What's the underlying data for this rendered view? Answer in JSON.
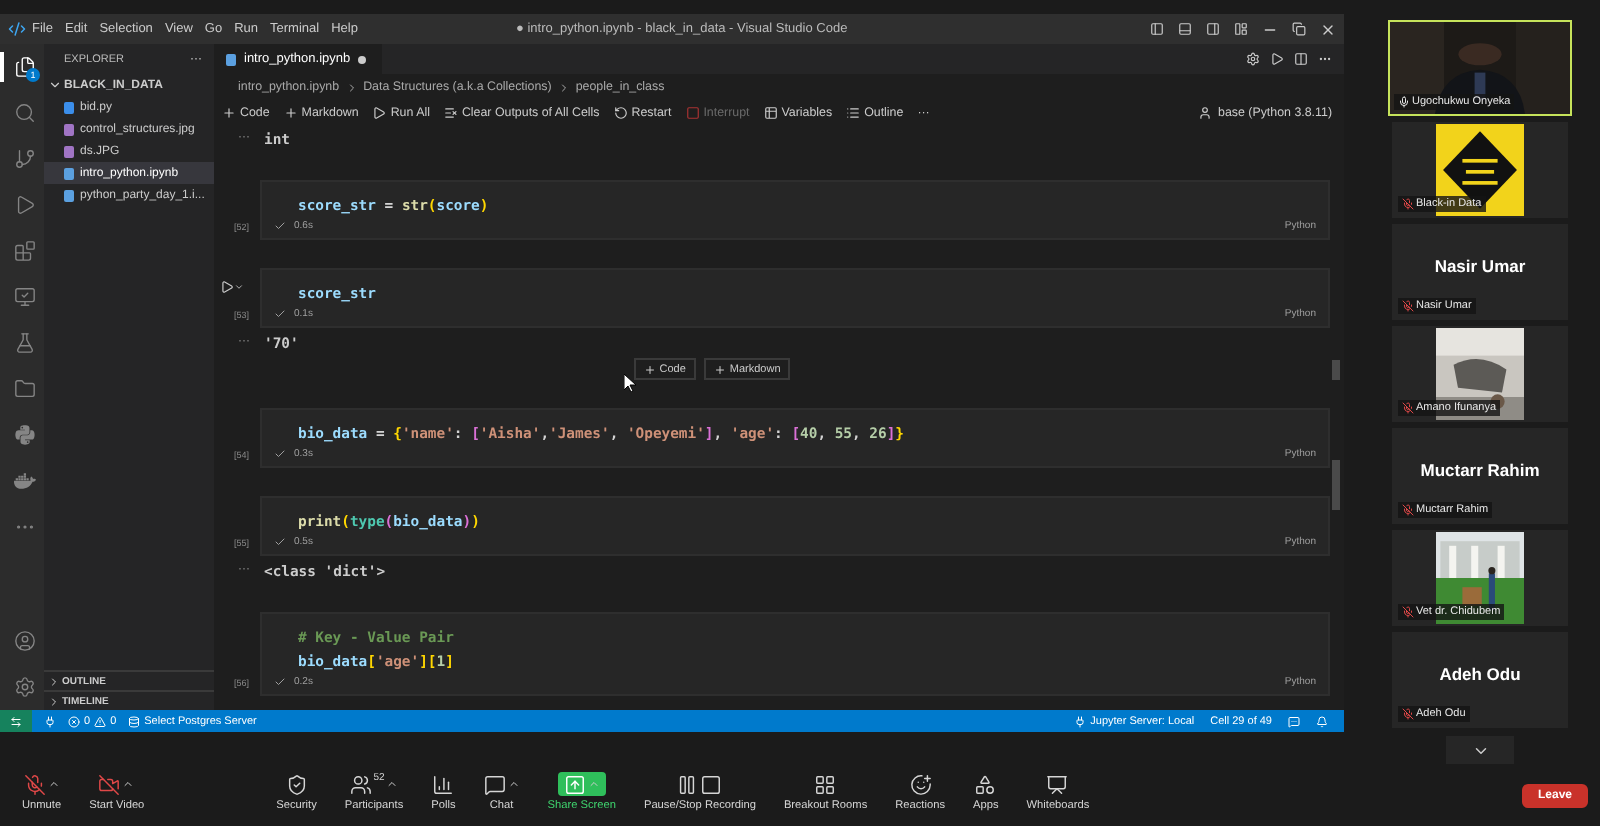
{
  "title_bar": {
    "menu": [
      "File",
      "Edit",
      "Selection",
      "View",
      "Go",
      "Run",
      "Terminal",
      "Help"
    ],
    "title": "● intro_python.ipynb - black_in_data - Visual Studio Code"
  },
  "activity_bar": [
    {
      "kind": "files",
      "selected": true,
      "badge": "1"
    },
    {
      "kind": "search",
      "selected": false
    },
    {
      "kind": "source_control",
      "selected": false
    },
    {
      "kind": "run",
      "selected": false
    },
    {
      "kind": "extensions",
      "selected": false
    },
    {
      "kind": "remote",
      "selected": false
    },
    {
      "kind": "testing",
      "selected": false
    },
    {
      "kind": "folder",
      "selected": false
    },
    {
      "kind": "python",
      "selected": false
    },
    {
      "kind": "docker",
      "selected": false
    },
    {
      "kind": "more",
      "selected": false
    }
  ],
  "sidebar": {
    "title": "EXPLORER",
    "more": "···",
    "folder": {
      "name": "BLACK_IN_DATA",
      "expanded": true,
      "files": [
        {
          "name": "bid.py",
          "kind": "python",
          "selected": false
        },
        {
          "name": "control_structures.jpg",
          "selected": false
        },
        {
          "name": "ds.JPG",
          "selected": false
        },
        {
          "name": "intro_python.ipynb",
          "kind": "notebook",
          "selected": true
        },
        {
          "name": "python_party_day_1.i...",
          "kind": "notebook",
          "selected": false
        }
      ]
    },
    "sections": [
      {
        "name": "OUTLINE",
        "expanded": false
      },
      {
        "name": "TIMELINE",
        "expanded": false
      }
    ]
  },
  "tabs": [
    {
      "label": "intro_python.ipynb",
      "selected": true,
      "dirty": true
    }
  ],
  "breadcrumb": [
    "intro_python.ipynb",
    "Data Structures (a.k.a Collections)",
    "people_in_class"
  ],
  "toolbar": {
    "actions": [
      {
        "label": "Code",
        "kind": "add",
        "disabled": false
      },
      {
        "label": "Markdown",
        "kind": "add",
        "disabled": false
      },
      {
        "label": "Run All",
        "kind": "run",
        "disabled": false
      },
      {
        "label": "Clear Outputs of All Cells",
        "kind": "clear",
        "disabled": false
      },
      {
        "label": "Restart",
        "kind": "restart",
        "disabled": false
      },
      {
        "label": "Interrupt",
        "kind": "interrupt",
        "disabled": true
      },
      {
        "label": "Variables",
        "kind": "variables",
        "disabled": false
      },
      {
        "label": "Outline",
        "kind": "outline",
        "disabled": false
      }
    ],
    "more": "···",
    "kernel": "base (Python 3.8.11)"
  },
  "notebook": [
    {
      "kind": "output",
      "prompt": "···",
      "text": "int"
    },
    {
      "kind": "cell",
      "label": "[52]",
      "run_control": false,
      "time": "0.6s",
      "language": "Python",
      "lines": [
        [
          {
            "text": "score_str",
            "kind": "var"
          },
          {
            "text": " = ",
            "kind": "op"
          },
          {
            "text": "str",
            "kind": "func"
          },
          {
            "text": "(",
            "kind": "b1"
          },
          {
            "text": "score",
            "kind": "var"
          },
          {
            "text": ")",
            "kind": "b1"
          }
        ]
      ]
    },
    {
      "kind": "cell",
      "label": "[53]",
      "run_control": true,
      "time": "0.1s",
      "language": "Python",
      "lines": [
        [
          {
            "text": "score_str",
            "kind": "var"
          }
        ]
      ]
    },
    {
      "kind": "output",
      "prompt": "···",
      "text": "'70'"
    },
    {
      "kind": "insert",
      "buttons": [
        "Code",
        "Markdown"
      ]
    },
    {
      "kind": "cell",
      "label": "[54]",
      "run_control": false,
      "time": "0.3s",
      "language": "Python",
      "lines": [
        [
          {
            "text": "bio_data",
            "kind": "var"
          },
          {
            "text": " = ",
            "kind": "op"
          },
          {
            "text": "{",
            "kind": "b1"
          },
          {
            "text": "'name'",
            "kind": "str"
          },
          {
            "text": ": ",
            "kind": "op"
          },
          {
            "text": "[",
            "kind": "b2"
          },
          {
            "text": "'Aisha'",
            "kind": "str"
          },
          {
            "text": ",",
            "kind": "op"
          },
          {
            "text": "'James'",
            "kind": "str"
          },
          {
            "text": ", ",
            "kind": "op"
          },
          {
            "text": "'Opeyemi'",
            "kind": "str"
          },
          {
            "text": "]",
            "kind": "b2"
          },
          {
            "text": ", ",
            "kind": "op"
          },
          {
            "text": "'age'",
            "kind": "str"
          },
          {
            "text": ": ",
            "kind": "op"
          },
          {
            "text": "[",
            "kind": "b2"
          },
          {
            "text": "40",
            "kind": "num"
          },
          {
            "text": ", ",
            "kind": "op"
          },
          {
            "text": "55",
            "kind": "num"
          },
          {
            "text": ", ",
            "kind": "op"
          },
          {
            "text": "26",
            "kind": "num"
          },
          {
            "text": "]",
            "kind": "b2"
          },
          {
            "text": "}",
            "kind": "b1"
          }
        ]
      ]
    },
    {
      "kind": "cell",
      "label": "[55]",
      "run_control": false,
      "time": "0.5s",
      "language": "Python",
      "lines": [
        [
          {
            "text": "print",
            "kind": "func"
          },
          {
            "text": "(",
            "kind": "b1"
          },
          {
            "text": "type",
            "kind": "cls"
          },
          {
            "text": "(",
            "kind": "b2"
          },
          {
            "text": "bio_data",
            "kind": "var"
          },
          {
            "text": ")",
            "kind": "b2"
          },
          {
            "text": ")",
            "kind": "b1"
          }
        ]
      ]
    },
    {
      "kind": "output",
      "prompt": "···",
      "text": "<class 'dict'>"
    },
    {
      "kind": "cell",
      "label": "[56]",
      "run_control": false,
      "time": "0.2s",
      "language": "Python",
      "lines": [
        [
          {
            "text": "# Key - Value Pair",
            "kind": "comment"
          }
        ],
        [
          {
            "text": "bio_data",
            "kind": "var"
          },
          {
            "text": "[",
            "kind": "b1"
          },
          {
            "text": "'age'",
            "kind": "str"
          },
          {
            "text": "]",
            "kind": "b1"
          },
          {
            "text": "[",
            "kind": "b1"
          },
          {
            "text": "1",
            "kind": "num"
          },
          {
            "text": "]",
            "kind": "b1"
          }
        ]
      ]
    }
  ],
  "status_bar": {
    "errors": "0",
    "warnings": "0",
    "postgres": "Select Postgres Server",
    "jupyter": "Jupyter Server: Local",
    "cell": "Cell 29 of 49"
  },
  "participants": [
    {
      "name": "Ugochukwu Onyeka",
      "kind": "picture",
      "speaking": true,
      "muted": false
    },
    {
      "name": "Black-in Data",
      "kind": "picture",
      "speaking": false,
      "muted": true
    },
    {
      "name": "Nasir Umar",
      "kind": "name_card",
      "card_text": "Nasir Umar",
      "speaking": false,
      "muted": true
    },
    {
      "name": "Amano Ifunanya",
      "kind": "picture",
      "speaking": false,
      "muted": true
    },
    {
      "name": "Muctarr Rahim",
      "kind": "name_card",
      "card_text": "Muctarr Rahim",
      "speaking": false,
      "muted": true
    },
    {
      "name": "Vet dr. Chidubem",
      "kind": "picture",
      "speaking": false,
      "muted": true
    },
    {
      "name": "Adeh Odu",
      "kind": "name_card",
      "card_text": "Adeh Odu",
      "speaking": false,
      "muted": true
    }
  ],
  "meeting_toolbar": {
    "items": [
      {
        "label": "Unmute",
        "kind": "mic",
        "caret": true,
        "off": true
      },
      {
        "label": "Start Video",
        "kind": "video",
        "caret": true,
        "off": true
      },
      {
        "label": "Security",
        "kind": "security",
        "caret": false
      },
      {
        "label": "Participants",
        "kind": "participants",
        "caret": true,
        "count": "52"
      },
      {
        "label": "Polls",
        "kind": "polls",
        "caret": false
      },
      {
        "label": "Chat",
        "kind": "chat",
        "caret": true
      },
      {
        "label": "Share Screen",
        "kind": "share",
        "caret": true
      },
      {
        "label": "Pause/Stop Recording",
        "kind": "recording",
        "caret": false
      },
      {
        "label": "Breakout Rooms",
        "kind": "breakout",
        "caret": false
      },
      {
        "label": "Reactions",
        "kind": "reactions",
        "caret": false
      },
      {
        "label": "Apps",
        "kind": "apps",
        "caret": false
      },
      {
        "label": "Whiteboards",
        "kind": "whiteboards",
        "caret": false
      }
    ],
    "leave": "Leave"
  }
}
